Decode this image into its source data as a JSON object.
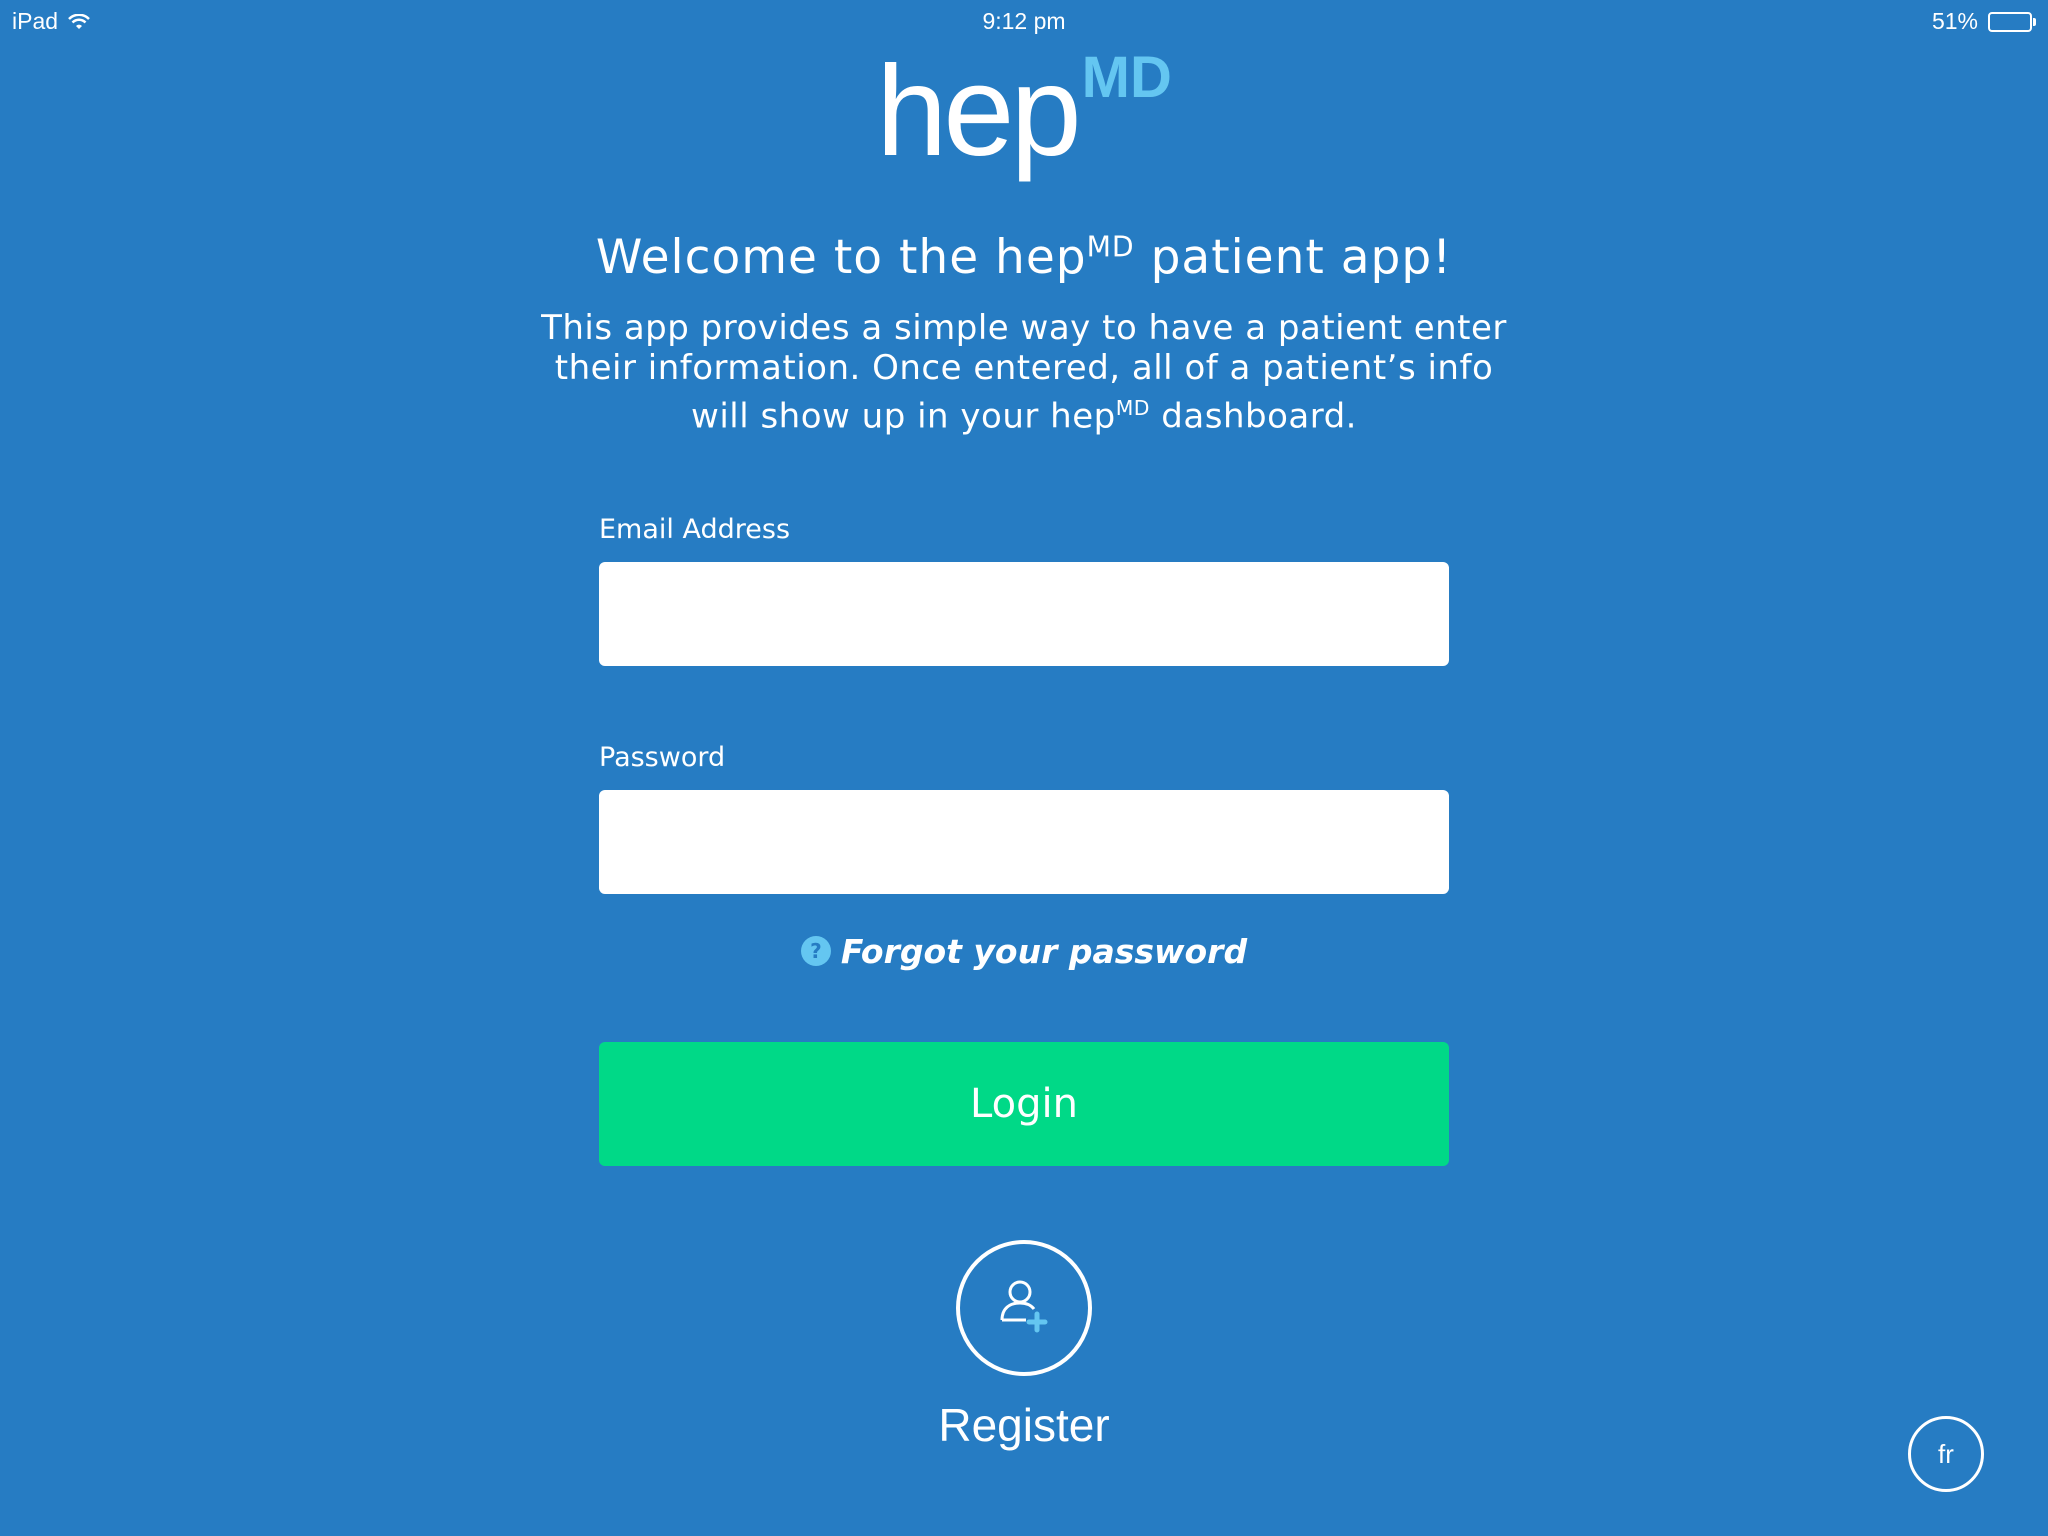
{
  "status_bar": {
    "device": "iPad",
    "time": "9:12 pm",
    "battery_percent_text": "51%",
    "battery_level": 0.51
  },
  "logo": {
    "main": "hep",
    "sup": "MD"
  },
  "welcome": {
    "before": "Welcome to the hep",
    "sup": "MD",
    "after": " patient app!"
  },
  "description": {
    "line1": "This app provides a simple way to have a patient enter",
    "line2": "their information. Once entered, all of a patient’s info",
    "line3_before": "will show up in your hep",
    "line3_sup": "MD",
    "line3_after": " dashboard."
  },
  "form": {
    "email_label": "Email Address",
    "email_value": "",
    "password_label": "Password",
    "password_value": "",
    "forgot_label": "Forgot your password",
    "forgot_icon": "?",
    "login_label": "Login"
  },
  "register": {
    "label": "Register",
    "icon": "user-add-icon"
  },
  "language": {
    "label": "fr"
  },
  "colors": {
    "background": "#267cc3",
    "accent_light_blue": "#64c6f1",
    "login_green": "#00d987"
  }
}
